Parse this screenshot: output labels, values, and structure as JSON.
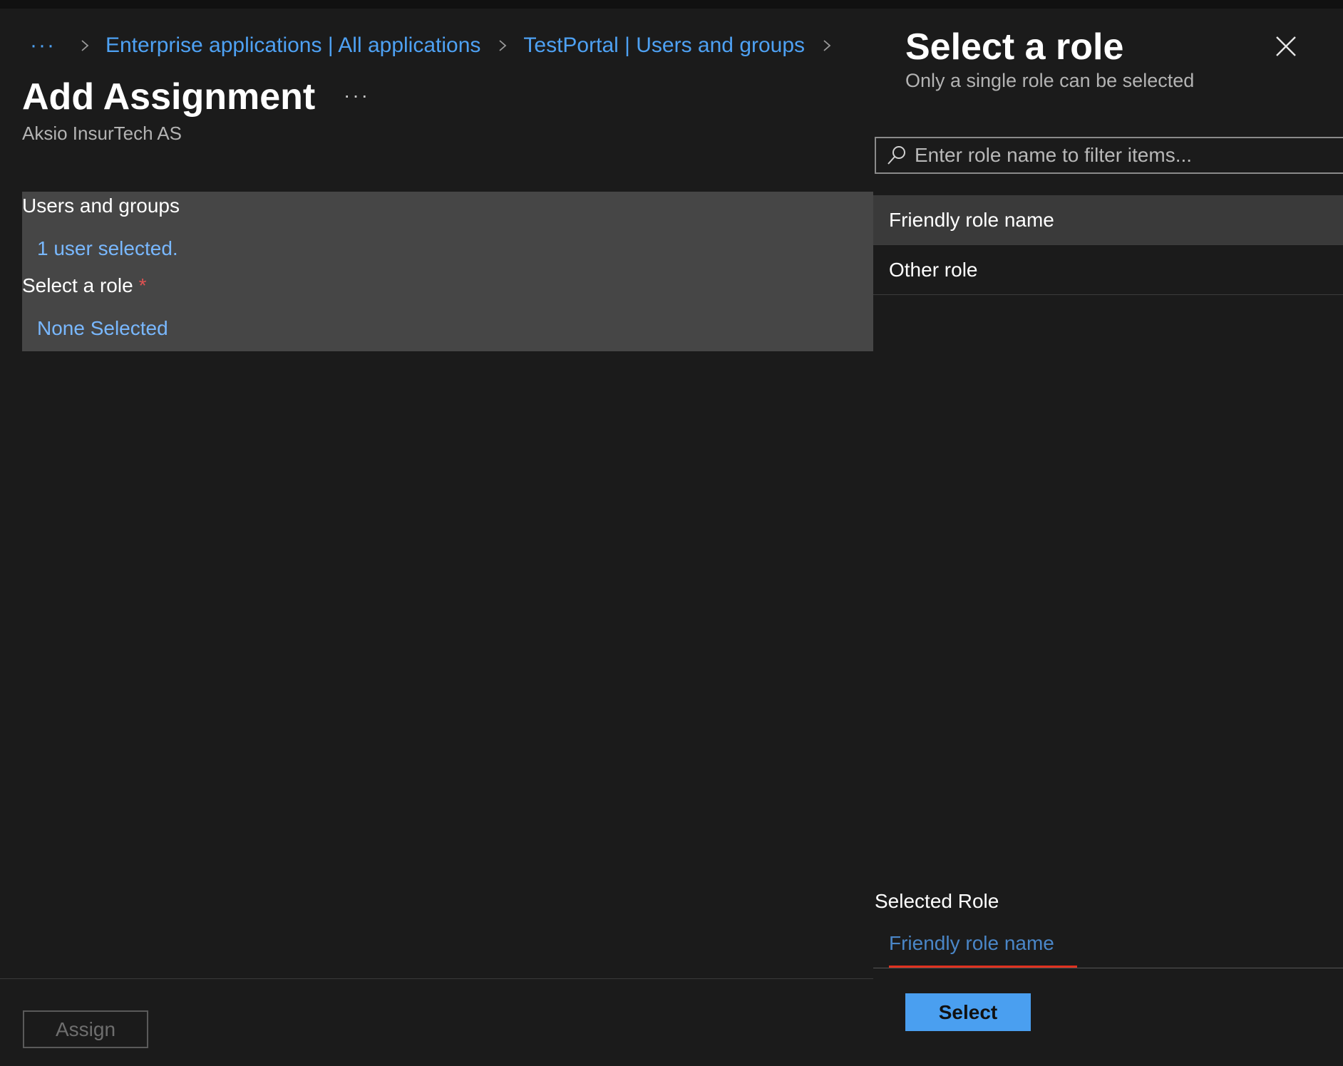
{
  "breadcrumb": {
    "ellipsis": "···",
    "items": [
      {
        "label": "Enterprise applications | All applications"
      },
      {
        "label": "TestPortal | Users and groups"
      }
    ]
  },
  "page": {
    "title": "Add Assignment",
    "more": "···",
    "subtitle": "Aksio InsurTech AS"
  },
  "form": {
    "users_label": "Users and groups",
    "users_value": "1 user selected.",
    "role_label": "Select a role",
    "role_required": "*",
    "role_value": "None Selected"
  },
  "footer": {
    "assign_label": "Assign"
  },
  "panel": {
    "title": "Select a role",
    "subtitle": "Only a single role can be selected",
    "search_placeholder": "Enter role name to filter items...",
    "roles": [
      {
        "label": "Friendly role name"
      },
      {
        "label": "Other role"
      }
    ],
    "selected_role_label": "Selected Role",
    "selected_role_value": "Friendly role name",
    "select_label": "Select"
  },
  "colors": {
    "link": "#4ea1f3",
    "accent_button": "#4a9ff0",
    "required": "#e05252",
    "selected_underline": "#e0311f"
  }
}
